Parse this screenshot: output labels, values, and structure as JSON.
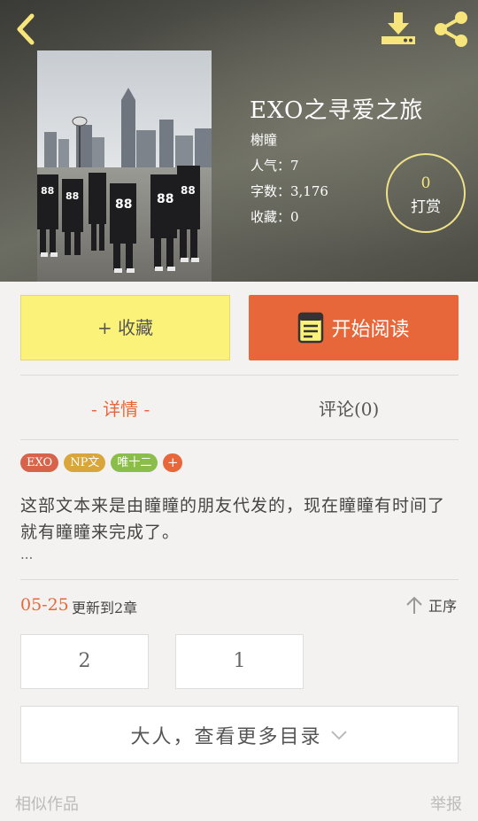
{
  "header": {
    "back_icon": "chevron-left-icon",
    "download_icon": "download-icon",
    "share_icon": "share-icon",
    "accent_color": "#f6e57a"
  },
  "book": {
    "title": "EXO之寻爱之旅",
    "author": "榭瞳",
    "popularity": "人气：7",
    "word_count": "字数：3,176",
    "favorites": "收藏：0",
    "cover_jersey": "88"
  },
  "reward": {
    "count": "0",
    "label": "打赏"
  },
  "actions": {
    "favorite_label": "+ 收藏",
    "read_label": "开始阅读",
    "favorite_color": "#fbf27a",
    "read_color": "#e8673a"
  },
  "tabs": {
    "detail": "- 详情 -",
    "comment": "评论(0)"
  },
  "tags": [
    {
      "label": "EXO",
      "color": "#d7634a"
    },
    {
      "label": "NP文",
      "color": "#d9a63b"
    },
    {
      "label": "唯十二",
      "color": "#8bbd4a"
    },
    {
      "label": "+",
      "color": "#e8673a"
    }
  ],
  "description": {
    "text": "这部文本来是由瞳瞳的朋友代发的，现在瞳瞳有时间了就有瞳瞳来完成了。",
    "more": "..."
  },
  "update": {
    "date": "05-25",
    "text": "更新到2章",
    "sort_label": "正序"
  },
  "chapters": [
    "2",
    "1"
  ],
  "catalog": {
    "more_label": "大人，查看更多目录"
  },
  "footer": {
    "similar": "相似作品",
    "report": "举报"
  }
}
